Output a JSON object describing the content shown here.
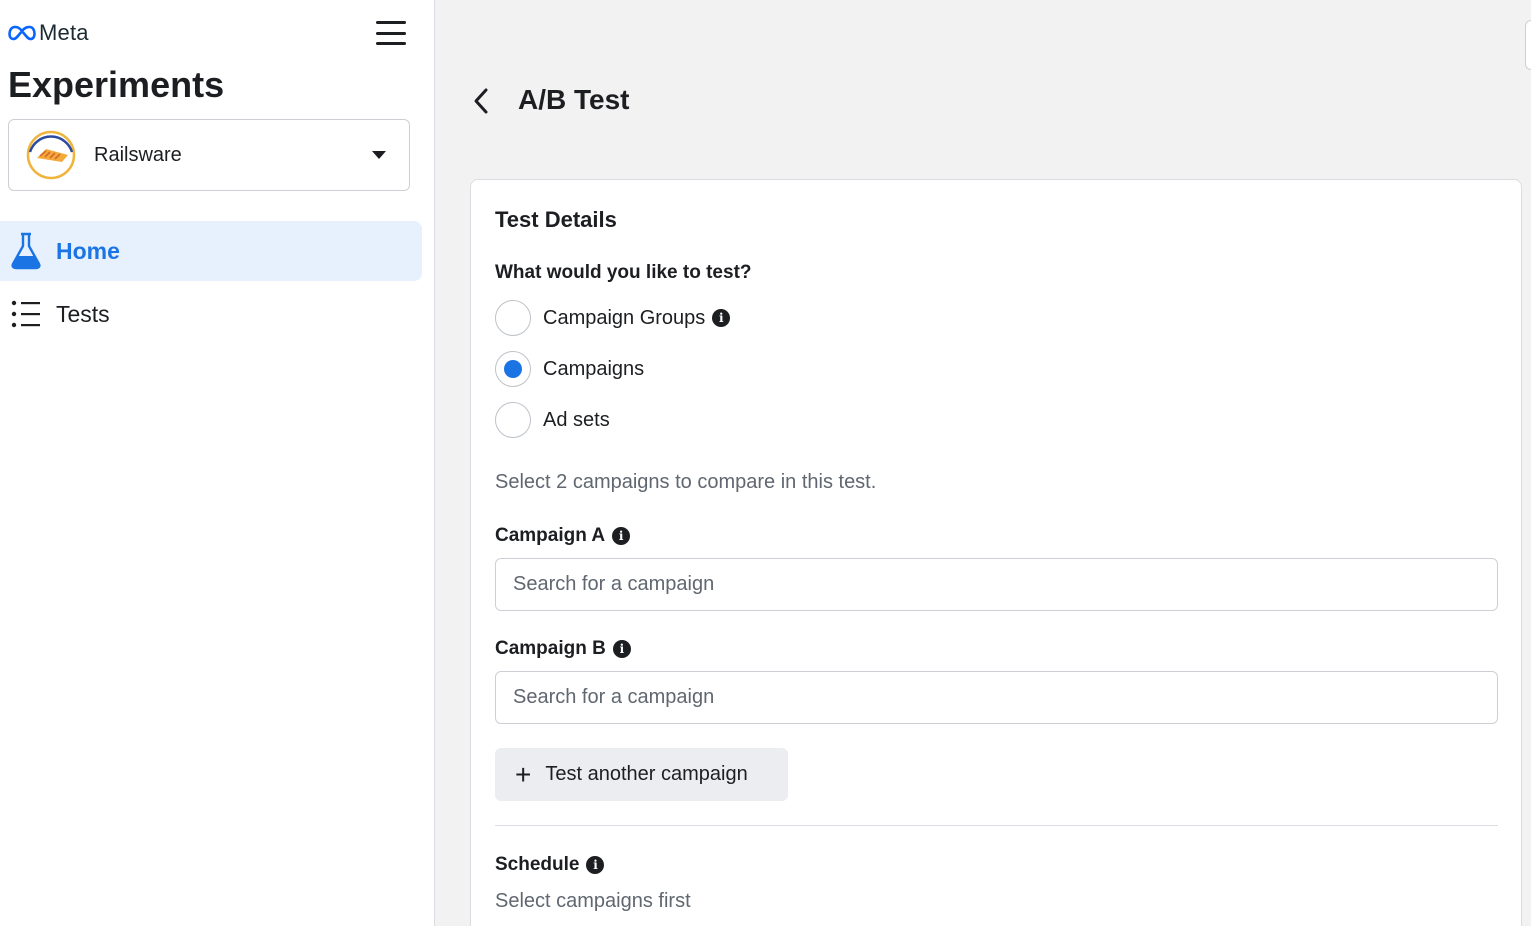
{
  "brand": {
    "logo_text": "Meta",
    "logo_color": "#0866ff"
  },
  "sidebar": {
    "app_title": "Experiments",
    "account": {
      "name": "Railsware"
    },
    "nav": [
      {
        "label": "Home",
        "icon": "flask-icon",
        "active": true
      },
      {
        "label": "Tests",
        "icon": "list-icon",
        "active": false
      }
    ]
  },
  "header": {
    "title": "A/B Test"
  },
  "test_details": {
    "title": "Test Details",
    "question": "What would you like to test?",
    "options": [
      {
        "label": "Campaign Groups",
        "selected": false,
        "has_info": true
      },
      {
        "label": "Campaigns",
        "selected": true,
        "has_info": false
      },
      {
        "label": "Ad sets",
        "selected": false,
        "has_info": false
      }
    ],
    "helper": "Select 2 campaigns to compare in this test.",
    "campaign_a": {
      "label": "Campaign A",
      "placeholder": "Search for a campaign",
      "value": ""
    },
    "campaign_b": {
      "label": "Campaign B",
      "placeholder": "Search for a campaign",
      "value": ""
    },
    "add_button": "Test another campaign",
    "schedule": {
      "label": "Schedule",
      "subtext": "Select campaigns first"
    }
  },
  "colors": {
    "accent": "#1b74e4",
    "active_nav_bg": "#e7f0fd"
  }
}
